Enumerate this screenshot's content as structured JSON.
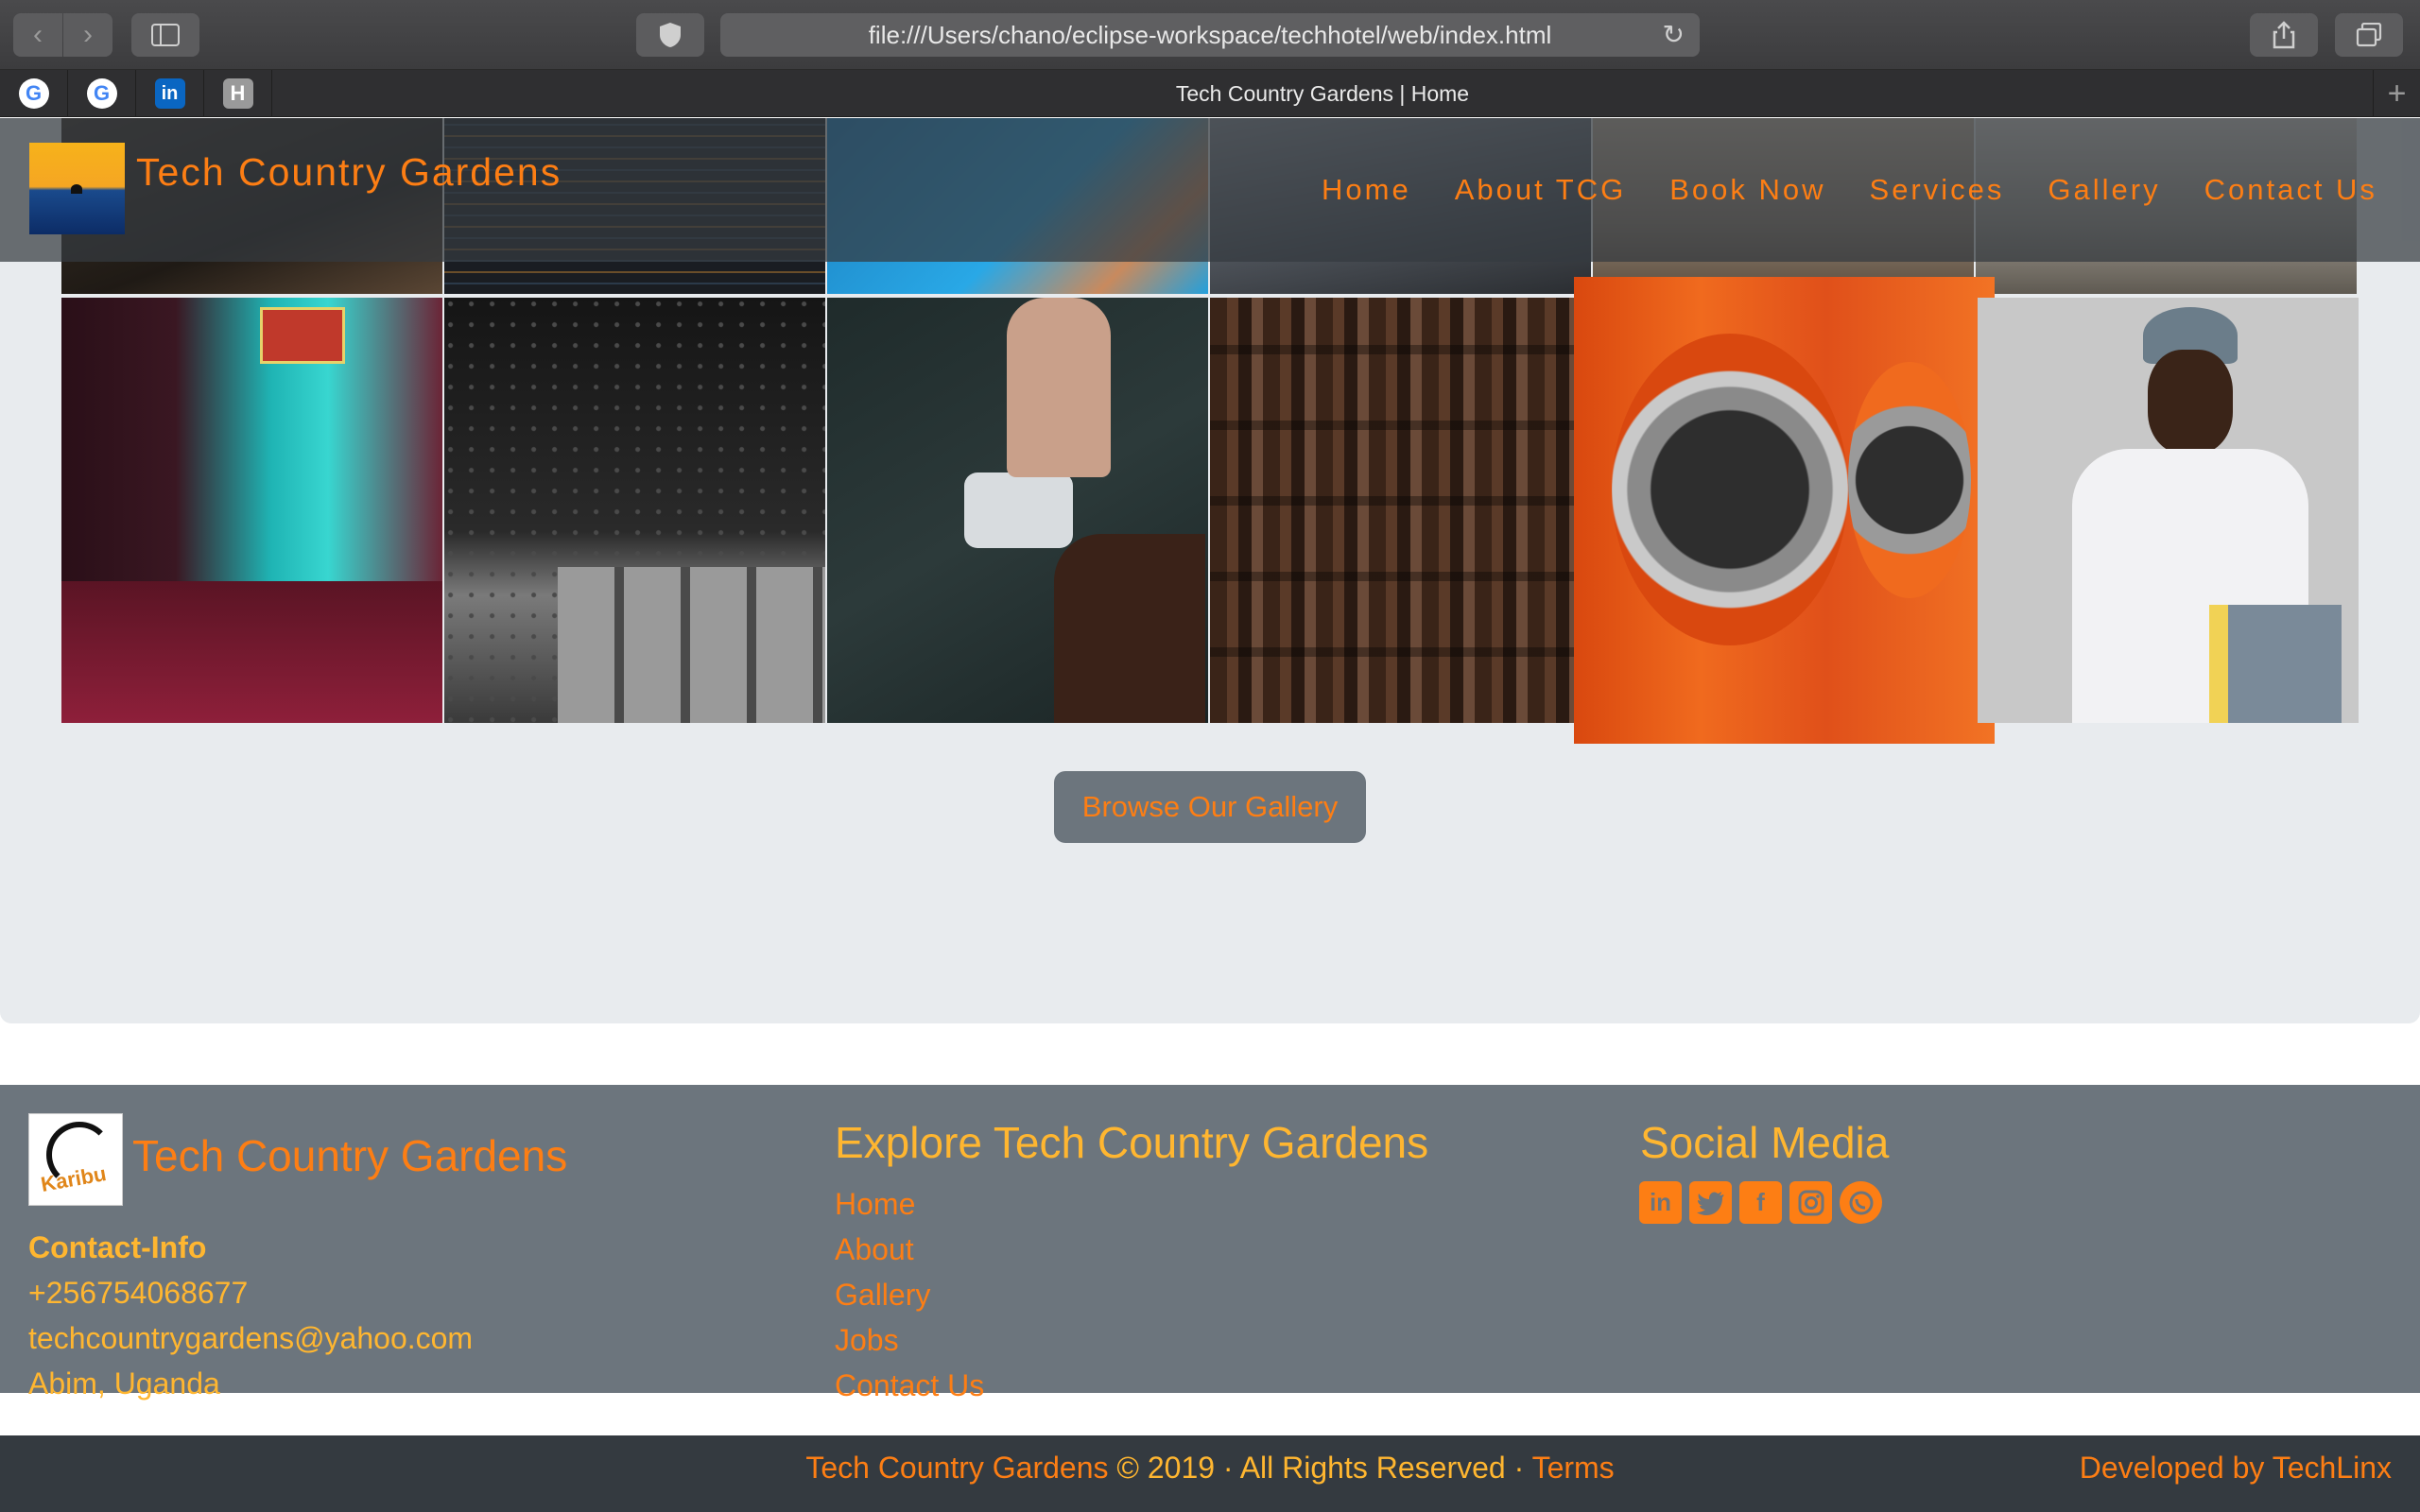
{
  "browser": {
    "url": "file:///Users/chano/eclipse-workspace/techhotel/web/index.html",
    "tab_title": "Tech Country Gardens | Home",
    "pinned_tabs": [
      "G",
      "G",
      "in",
      "H"
    ]
  },
  "header": {
    "brand": "Tech Country Gardens",
    "nav": [
      "Home",
      "About TCG",
      "Book Now",
      "Services",
      "Gallery",
      "Contact Us"
    ]
  },
  "gallery": {
    "button_label": "Browse Our Gallery"
  },
  "footer": {
    "brand": "Tech Country Gardens",
    "logo_text": "Karibu",
    "contact_heading": "Contact-Info",
    "phone": "+256754068677",
    "email": "techcountrygardens@yahoo.com",
    "location": "Abim, Uganda",
    "explore_heading": "Explore Tech Country Gardens",
    "explore_links": [
      "Home",
      "About",
      "Gallery",
      "Jobs",
      "Contact Us"
    ],
    "social_heading": "Social Media",
    "social_icons": [
      "linkedin-icon",
      "twitter-icon",
      "facebook-icon",
      "instagram-icon",
      "whatsapp-icon"
    ]
  },
  "bottom_bar": {
    "copyright_brand": "Tech Country Gardens",
    "copyright_rest": " © 2019 · All Rights Reserved · ",
    "terms": "Terms",
    "developer": "Developed by TechLinx"
  },
  "colors": {
    "accent": "#fd7e14",
    "accent_light": "#ffb630",
    "footer_bg": "#6c757d",
    "bottom_bg": "#343a40",
    "hero_bg": "#e8ebee"
  }
}
